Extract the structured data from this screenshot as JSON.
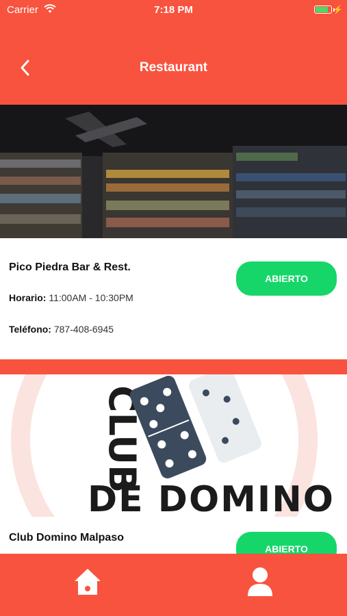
{
  "status_bar": {
    "carrier": "Carrier",
    "time": "7:18 PM"
  },
  "header": {
    "title": "Restaurant",
    "back_icon": "chevron-left-icon"
  },
  "colors": {
    "primary": "#F7533E",
    "open_button": "#16D66A"
  },
  "listings": [
    {
      "name": "Pico Piedra Bar & Rest.",
      "hours_label": "Horario:",
      "hours_value": "11:00AM - 10:30PM",
      "phone_label": "Teléfono:",
      "phone_value": "787-408-6945",
      "status": "ABIERTO"
    },
    {
      "name": "Club Domino Malpaso",
      "status": "ABIERTO",
      "logo_text_top": "CLUB",
      "logo_text_bottom": "DE DOMINO"
    }
  ],
  "tabbar": {
    "items": [
      "home-icon",
      "profile-icon"
    ]
  }
}
